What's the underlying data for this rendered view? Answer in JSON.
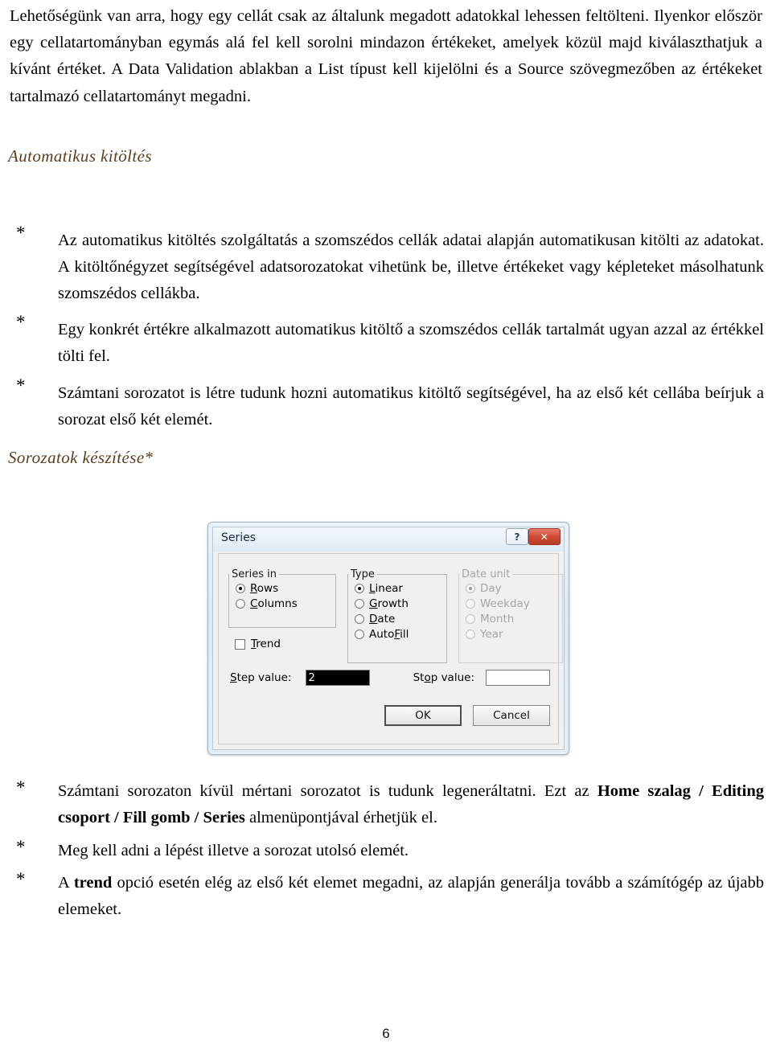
{
  "document": {
    "language": "hu",
    "page_number": "6",
    "heading_color": "#5a3e22",
    "intro_paragraph": "Lehetőségünk van arra, hogy egy cellát csak az általunk megadott adatokkal lehessen feltölteni. Ilyenkor először egy cellatartományban egymás alá fel kell sorolni mindazon értékeket, amelyek közül majd kiválaszthatjuk a kívánt értéket. A Data Validation ablakban a List típust kell kijelölni és a Source szövegmezőben az értékeket tartalmazó cellatartományt megadni."
  },
  "sections": {
    "autofill": {
      "heading": "Automatikus kitöltés",
      "bullet_mark": "*",
      "bullets": [
        {
          "text": "Az automatikus kitöltés szolgáltatás a szomszédos cellák adatai alapján automatikusan kitölti az adatokat. A kitöltőnégyzet segítségével adatsorozatokat vihetünk be, illetve értékeket vagy képleteket másolhatunk szomszédos cellákba."
        },
        {
          "text": "Egy konkrét értékre alkalmazott automatikus kitöltő a szomszédos cellák tartalmát ugyan azzal az értékkel tölti fel."
        },
        {
          "text": "Számtani sorozatot is létre tudunk hozni automatikus kitöltő segítségével, ha az első két cellába beírjuk a sorozat első két elemét."
        }
      ]
    },
    "series": {
      "heading": "Sorozatok készítése*",
      "bullet_mark": "*",
      "bullets": [
        {
          "parts": [
            {
              "text": "Számtani sorozaton kívül mértani sorozatot is tudunk legeneráltatni. Ezt az ",
              "bold": false
            },
            {
              "text": "Home szalag / Editing csoport / Fill gomb / Series",
              "bold": true
            },
            {
              "text": " almenüpontjával érhetjük el.",
              "bold": false
            }
          ]
        },
        {
          "parts": [
            {
              "text": "Meg kell adni a lépést illetve a sorozat utolsó elemét.",
              "bold": false
            }
          ]
        },
        {
          "parts": [
            {
              "text": "A ",
              "bold": false
            },
            {
              "text": "trend",
              "bold": true
            },
            {
              "text": " opció esetén elég az első két elemet megadni, az alapján generálja tovább a számítógép az újabb elemeket.",
              "bold": false
            }
          ]
        }
      ]
    }
  },
  "series_dialog": {
    "title": "Series",
    "help_button": "?",
    "close_button": "✕",
    "groups": {
      "series_in": {
        "legend": "Series in",
        "enabled": true,
        "options": [
          {
            "label": "Rows",
            "accel": "R",
            "selected": true
          },
          {
            "label": "Columns",
            "accel": "C",
            "selected": false
          }
        ]
      },
      "type": {
        "legend": "Type",
        "enabled": true,
        "options": [
          {
            "label": "Linear",
            "accel": "L",
            "selected": true
          },
          {
            "label": "Growth",
            "accel": "G",
            "selected": false
          },
          {
            "label": "Date",
            "accel": "D",
            "selected": false
          },
          {
            "label": "AutoFill",
            "accel": "F",
            "selected": false
          }
        ]
      },
      "date_unit": {
        "legend": "Date unit",
        "enabled": false,
        "options": [
          {
            "label": "Day",
            "accel": "D",
            "selected": true
          },
          {
            "label": "Weekday",
            "accel": "W",
            "selected": false
          },
          {
            "label": "Month",
            "accel": "M",
            "selected": false
          },
          {
            "label": "Year",
            "accel": "Y",
            "selected": false
          }
        ]
      }
    },
    "trend": {
      "label": "Trend",
      "accel": "T",
      "checked": false
    },
    "step_value": {
      "label": "Step value:",
      "accel": "S",
      "value": "2",
      "selected": true
    },
    "stop_value": {
      "label": "Stop value:",
      "accel": "o",
      "value": "",
      "placeholder": ""
    },
    "buttons": {
      "ok": "OK",
      "cancel": "Cancel"
    }
  }
}
